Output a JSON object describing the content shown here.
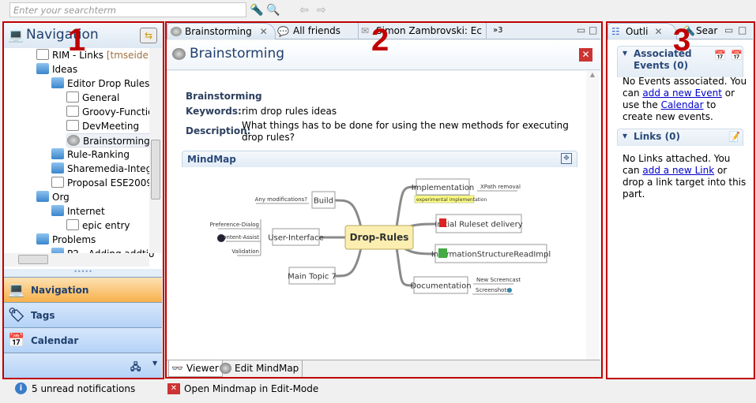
{
  "toolbar": {
    "search_placeholder": "Enter your searchterm",
    "icons": [
      "flashlight-icon",
      "search-history-icon",
      "back-arrow-icon",
      "forward-arrow-icon"
    ]
  },
  "annotations": [
    "1",
    "2",
    "3"
  ],
  "left": {
    "title": "Navigation",
    "tree": [
      {
        "label": "RIM - Links",
        "suffix": " [tmseidel@",
        "icon": "link-icon",
        "level": 2
      },
      {
        "label": "Ideas",
        "icon": "folder",
        "level": 2
      },
      {
        "label": "Editor Drop Rules",
        "icon": "folder",
        "level": 3
      },
      {
        "label": "General",
        "icon": "doc",
        "level": 4
      },
      {
        "label": "Groovy-Functio",
        "icon": "doc",
        "level": 4
      },
      {
        "label": "DevMeeting",
        "icon": "doc",
        "level": 4
      },
      {
        "label": "Brainstorming",
        "icon": "brain",
        "level": 4,
        "selected": true
      },
      {
        "label": "Rule-Ranking",
        "icon": "folder",
        "level": 3
      },
      {
        "label": "Sharemedia-Integra",
        "icon": "folder",
        "level": 3
      },
      {
        "label": "Proposal ESE2009",
        "icon": "doc",
        "level": 3
      },
      {
        "label": "Org",
        "icon": "folder",
        "level": 2
      },
      {
        "label": "Internet",
        "icon": "folder",
        "level": 3
      },
      {
        "label": "epic entry",
        "icon": "doc",
        "level": 4
      },
      {
        "label": "Problems",
        "icon": "folder",
        "level": 2
      },
      {
        "label": "P2 - Adding addtio",
        "icon": "folder",
        "level": 3
      }
    ],
    "bars": [
      {
        "label": "Navigation",
        "selected": true
      },
      {
        "label": "Tags"
      },
      {
        "label": "Calendar"
      }
    ]
  },
  "editor": {
    "tabs": [
      {
        "label": "Brainstorming",
        "active": true
      },
      {
        "label": "All friends"
      },
      {
        "label": "Simon Zambrovski: Ec"
      },
      {
        "label": "3"
      }
    ],
    "title": "Brainstorming",
    "name": "Brainstorming",
    "keywords_label": "Keywords:",
    "keywords": "rim drop rules ideas",
    "description_label": "Description:",
    "description": "What things has to be done for using the new methods for executing drop rules?",
    "mindmap_label": "MindMap",
    "mindmap": {
      "central": "Drop-Rules",
      "nodes": {
        "build": "Build",
        "any": "Any modifications?",
        "ui": "User-Interface",
        "pref": "Preference-Dialog",
        "ca": "Content-Assist",
        "val": "Validation",
        "main7": "Main Topic 7",
        "impl": "Implementation",
        "xpath": "XPath removal",
        "note": "experimental implementation",
        "init": "Initial Ruleset delivery",
        "isr": "InformationStructureReadImpl",
        "doc": "Documentation",
        "screencast": "New Screencast",
        "screenshots": "Screenshots"
      }
    },
    "subtabs": [
      "Viewer",
      "Edit MindMap"
    ]
  },
  "right": {
    "tabs": [
      "Outli",
      "Sear"
    ],
    "events": {
      "title": "Associated Events (0)",
      "t1": "No Events associated. You can ",
      "link1": "add a new Event",
      "t2": " or use the ",
      "link2": "Calendar",
      "t3": " to create new events."
    },
    "links": {
      "title": "Links (0)",
      "t1": "No Links attached. You can ",
      "link1": "add a new Link",
      "t2": " or drop a link target into this part."
    }
  },
  "status": {
    "notifications": "5 unread notifications",
    "message": "Open Mindmap in Edit-Mode"
  },
  "colors": {
    "annotation": "#c00000",
    "selected_bar": "#f8b04b",
    "bar": "#b4d2f7",
    "link": "#0000cc"
  }
}
